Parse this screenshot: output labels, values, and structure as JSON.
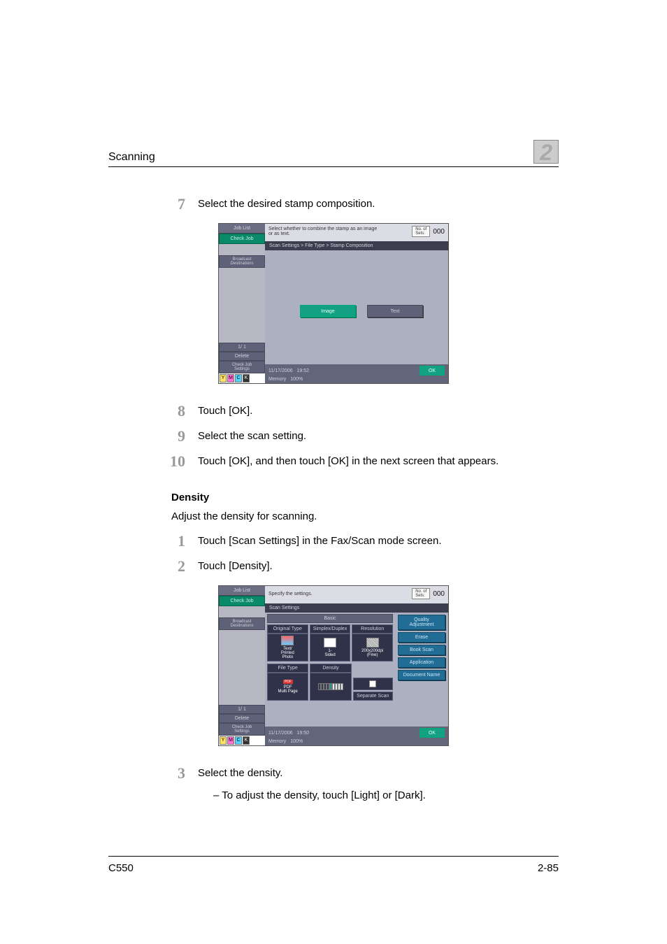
{
  "header": {
    "section": "Scanning",
    "chapter": "2"
  },
  "steps1": {
    "s7": {
      "num": "7",
      "text": "Select the desired stamp composition."
    },
    "s8": {
      "num": "8",
      "text": "Touch [OK]."
    },
    "s9": {
      "num": "9",
      "text": "Select the scan setting."
    },
    "s10": {
      "num": "10",
      "text": "Touch [OK], and then touch [OK] in the next screen that appears."
    }
  },
  "density": {
    "heading": "Density",
    "intro": "Adjust the density for scanning.",
    "s1": {
      "num": "1",
      "text": "Touch [Scan Settings] in the Fax/Scan mode screen."
    },
    "s2": {
      "num": "2",
      "text": "Touch [Density]."
    },
    "s3": {
      "num": "3",
      "text": "Select the density."
    },
    "s3sub": "– To adjust the density, touch [Light] or [Dark]."
  },
  "screen1": {
    "joblist": "Job List",
    "checkjob": "Check Job",
    "broadcast": "Broadcast\nDestinations",
    "page": "1/ 1",
    "delete": "Delete",
    "checkset": "Check Job\nSettings",
    "msg": "Select whether to combine the stamp as an image or as text.",
    "copieslbl": "No. of\nSets:",
    "copiesn": "000",
    "crumb": "Scan Settings > File Type > Stamp Composition",
    "image": "Image",
    "text": "Text",
    "date": "11/17/2006",
    "time": "19:52",
    "mem": "Memory",
    "memv": "100%",
    "ok": "OK",
    "y": "Y",
    "m": "M",
    "c": "C",
    "k": "K"
  },
  "screen2": {
    "joblist": "Job List",
    "checkjob": "Check Job",
    "broadcast": "Broadcast\nDestinations",
    "page": "1/ 1",
    "delete": "Delete",
    "checkset": "Check Job\nSettings",
    "msg": "Specify the settings.",
    "copieslbl": "No. of\nSets:",
    "copiesn": "000",
    "crumb": "Scan Settings",
    "basic": "Basic",
    "origtype": "Original Type",
    "simplex": "Simplex/Duplex",
    "resolution": "Resolution",
    "origval": "Text/\nPrinted\nPhoto",
    "simval": "1-\nSided",
    "resval": "200x200dpi\n(Fine)",
    "filetype": "File Type",
    "density": "Density",
    "pdf": "PDF",
    "pdfmp": "PDF\nMulti Page",
    "sepscan": "Separate Scan",
    "quality": "Quality\nAdjustment",
    "erase": "Erase",
    "book": "Book Scan",
    "app": "Application",
    "docname": "Document Name",
    "date": "11/17/2006",
    "time": "19:50",
    "mem": "Memory",
    "memv": "100%",
    "ok": "OK",
    "y": "Y",
    "m": "M",
    "c": "C",
    "k": "K"
  },
  "footer": {
    "model": "C550",
    "page": "2-85"
  }
}
